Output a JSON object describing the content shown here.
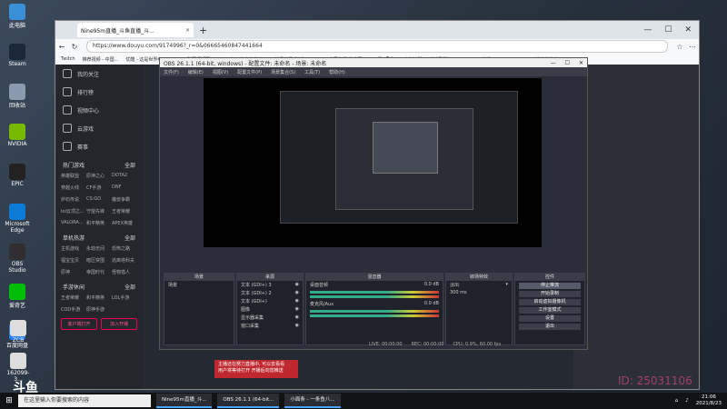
{
  "desktop_icons": [
    {
      "label": "此电脑",
      "color": "#3a8fd9"
    },
    {
      "label": "Steam",
      "color": "#1b2838"
    },
    {
      "label": "回收站",
      "color": "#8a9bb0"
    },
    {
      "label": "NVIDIA",
      "color": "#76b900"
    },
    {
      "label": "EPIC",
      "color": "#222"
    },
    {
      "label": "Microsoft Edge",
      "color": "#0c7bd8"
    },
    {
      "label": "OBS Studio",
      "color": "#302e31"
    },
    {
      "label": "爱奇艺",
      "color": "#00be06"
    },
    {
      "label": "百度网盘",
      "color": "#2a7ef4"
    },
    {
      "label": "ZCB",
      "color": "#ddd"
    },
    {
      "label": "162099-3...",
      "color": "#ddd"
    }
  ],
  "browser": {
    "tab_title": "Nine95m直播_斗鱼直播_斗...",
    "url": "https://www.douyu.com/9174996?_r=0&06665460847441664",
    "bookmarks": [
      "Twitch",
      "推荐视频 - 中国...",
      "优酷 - 这是世界级...",
      "AcFun弹幕视频网 - ...",
      "斗鱼 - 每个人的直...",
      "哔哩哔哩 (゜-゜)つロ...",
      "虎牙直播-技术驱动...",
      "YouTube",
      "虎扑篮球",
      "英雄联盟 - LOL - LE...",
      "熊猫 - hu yi - Outlo...",
      "其他收藏夹"
    ]
  },
  "sidebar": {
    "items": [
      "我的关注",
      "排行榜",
      "视频中心",
      "云游戏",
      "赛事"
    ],
    "section1": "热门游戏",
    "section1_more": "全部",
    "games": [
      "英雄联盟",
      "原神之心",
      "DOTA2",
      "穿越火线",
      "CF手游",
      "DNF",
      "炉石传说",
      "CS:GO",
      "魔兽争霸",
      "lol云顶之...",
      "守望先锋",
      "王者荣耀",
      "VALORA...",
      "和平精英",
      "APEX英雄"
    ],
    "section2": "单机热游",
    "section2_more": "全部",
    "single": [
      "主机游戏",
      "永劫无间",
      "恐怖之路",
      "福宝宝贝",
      "暗区突围",
      "逃离塔科夫",
      "原神",
      "帝国时代",
      "怪物猎人"
    ],
    "section3": "手游休闲",
    "section3_more": "全部",
    "mobile": [
      "王者荣耀",
      "和平精英",
      "LOL手游",
      "COD手游",
      "原神手游"
    ],
    "btn_client": "客户端打开",
    "btn_live": "加入开播"
  },
  "obs": {
    "title": "OBS 26.1.1 (64-bit, windows) - 配置文件: 未命名 - 场景: 未命名",
    "menu": [
      "文件(F)",
      "编辑(E)",
      "视图(V)",
      "配置文件(P)",
      "场景集合(S)",
      "工具(T)",
      "帮助(H)"
    ],
    "scenes_header": "场景",
    "scenes": [
      "场景"
    ],
    "sources_header": "来源",
    "sources": [
      "文本 (GDI+) 3",
      "文本 (GDI+) 2",
      "文本 (GDI+)",
      "图像",
      "显示器采集",
      "窗口采集"
    ],
    "mixer_header": "混音器",
    "mixer": [
      {
        "name": "桌面音频",
        "db": "0.0 dB"
      },
      {
        "name": "麦克风/Aux",
        "db": "0.0 dB"
      }
    ],
    "transitions_header": "转场特效",
    "transition": "淡出",
    "duration": "300 ms",
    "controls_header": "控件",
    "controls": [
      "停止推流",
      "开始录制",
      "启动虚拟摄像机",
      "工作室模式",
      "设置",
      "退出"
    ],
    "status": [
      "LIVE: 00:00:00",
      "REC: 00:00:00",
      "CPU: 0.9%, 60.00 fps"
    ]
  },
  "popup": {
    "line1": "主播还在努力直播中, 可以去看看",
    "line2": "用户将等待打开 开播后向您推送"
  },
  "taskbar": {
    "search_placeholder": "在这里输入你要搜索的内容",
    "apps": [
      "Nine95m直播_斗...",
      "OBS 26.1.1 (64-bit...",
      "小面条 - 一条鱼八..."
    ],
    "time": "21:06",
    "date": "2021/8/23"
  },
  "watermark": "ID: 25031106",
  "logo_text": "斗鱼"
}
